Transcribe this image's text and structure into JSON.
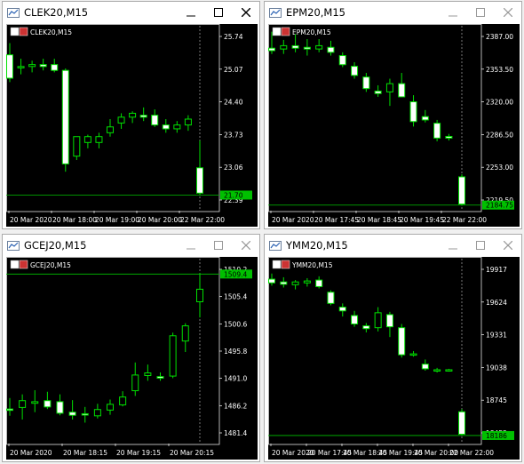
{
  "windows": [
    {
      "key": "w0",
      "title": "CLEK20,M15",
      "active": true,
      "symbol_label": "CLEK20,M15",
      "price_labels": [
        "25.74",
        "25.07",
        "24.40",
        "23.73",
        "23.06",
        "22.39"
      ],
      "current_price": "21.70",
      "time_labels": [
        "20 Mar 2020",
        "20 Mar 18:00",
        "20 Mar 19:00",
        "20 Mar 20:00",
        "22 Mar 22:00"
      ],
      "chart_data": {
        "type": "candlestick",
        "ylim": [
          21.3,
          26.0
        ],
        "candles": [
          {
            "o": 25.3,
            "h": 25.6,
            "l": 24.6,
            "c": 24.7
          },
          {
            "o": 25.0,
            "h": 25.2,
            "l": 24.8,
            "c": 25.0
          },
          {
            "o": 25.0,
            "h": 25.15,
            "l": 24.85,
            "c": 25.05
          },
          {
            "o": 25.05,
            "h": 25.2,
            "l": 24.9,
            "c": 25.0
          },
          {
            "o": 25.05,
            "h": 25.2,
            "l": 24.85,
            "c": 24.9
          },
          {
            "o": 24.9,
            "h": 24.95,
            "l": 22.3,
            "c": 22.5
          },
          {
            "o": 22.7,
            "h": 23.2,
            "l": 22.6,
            "c": 23.2
          },
          {
            "o": 23.05,
            "h": 23.25,
            "l": 22.9,
            "c": 23.2
          },
          {
            "o": 23.05,
            "h": 23.3,
            "l": 22.9,
            "c": 23.2
          },
          {
            "o": 23.3,
            "h": 23.65,
            "l": 23.2,
            "c": 23.45
          },
          {
            "o": 23.55,
            "h": 23.8,
            "l": 23.4,
            "c": 23.7
          },
          {
            "o": 23.7,
            "h": 23.85,
            "l": 23.55,
            "c": 23.8
          },
          {
            "o": 23.75,
            "h": 23.95,
            "l": 23.6,
            "c": 23.7
          },
          {
            "o": 23.75,
            "h": 23.9,
            "l": 23.45,
            "c": 23.5
          },
          {
            "o": 23.5,
            "h": 23.65,
            "l": 23.3,
            "c": 23.4
          },
          {
            "o": 23.4,
            "h": 23.6,
            "l": 23.3,
            "c": 23.5
          },
          {
            "o": 23.5,
            "h": 23.75,
            "l": 23.35,
            "c": 23.65
          },
          {
            "o": 22.4,
            "h": 23.1,
            "l": 21.7,
            "c": 21.75
          }
        ]
      }
    },
    {
      "key": "w1",
      "title": "EPM20,M15",
      "active": false,
      "symbol_label": "EPM20,M15",
      "price_labels": [
        "2387.00",
        "2353.50",
        "2320.00",
        "2286.50",
        "2253.00",
        "2219.50"
      ],
      "current_price": "2184.75",
      "time_labels": [
        "20 Mar 2020",
        "20 Mar 17:45",
        "20 Mar 18:45",
        "20 Mar 19:45",
        "22 Mar 22:00"
      ],
      "chart_data": {
        "type": "candlestick",
        "ylim": [
          2178,
          2400
        ],
        "candles": [
          {
            "o": 2375,
            "h": 2395,
            "l": 2368,
            "c": 2372
          },
          {
            "o": 2374,
            "h": 2385,
            "l": 2368,
            "c": 2378
          },
          {
            "o": 2378,
            "h": 2392,
            "l": 2370,
            "c": 2375
          },
          {
            "o": 2376,
            "h": 2386,
            "l": 2366,
            "c": 2374
          },
          {
            "o": 2374,
            "h": 2386,
            "l": 2370,
            "c": 2378
          },
          {
            "o": 2376,
            "h": 2384,
            "l": 2366,
            "c": 2370
          },
          {
            "o": 2366,
            "h": 2370,
            "l": 2352,
            "c": 2355
          },
          {
            "o": 2353,
            "h": 2358,
            "l": 2338,
            "c": 2342
          },
          {
            "o": 2340,
            "h": 2345,
            "l": 2322,
            "c": 2326
          },
          {
            "o": 2323,
            "h": 2330,
            "l": 2316,
            "c": 2320
          },
          {
            "o": 2322,
            "h": 2338,
            "l": 2305,
            "c": 2332
          },
          {
            "o": 2332,
            "h": 2345,
            "l": 2318,
            "c": 2316
          },
          {
            "o": 2310,
            "h": 2318,
            "l": 2280,
            "c": 2286
          },
          {
            "o": 2292,
            "h": 2300,
            "l": 2285,
            "c": 2288
          },
          {
            "o": 2284,
            "h": 2288,
            "l": 2262,
            "c": 2266
          },
          {
            "o": 2268,
            "h": 2271,
            "l": 2263,
            "c": 2266
          },
          {
            "o": 2219,
            "h": 2222,
            "l": 2184,
            "c": 2186
          }
        ]
      }
    },
    {
      "key": "w2",
      "title": "GCEJ20,M15",
      "active": false,
      "symbol_label": "GCEJ20,M15",
      "price_labels": [
        "1510.2",
        "1505.4",
        "1500.6",
        "1495.8",
        "1491.0",
        "1486.2",
        "1481.4"
      ],
      "current_price": "1509.4",
      "time_labels": [
        "20 Mar 2020",
        "20 Mar 18:15",
        "20 Mar 19:15",
        "20 Mar 20:15"
      ],
      "chart_data": {
        "type": "candlestick",
        "ylim": [
          1477,
          1512
        ],
        "candles": [
          {
            "o": 1483.6,
            "h": 1485.7,
            "l": 1482.3,
            "c": 1483.4
          },
          {
            "o": 1483.9,
            "h": 1486.4,
            "l": 1481.6,
            "c": 1485.2
          },
          {
            "o": 1484.7,
            "h": 1487.2,
            "l": 1483.0,
            "c": 1485.0
          },
          {
            "o": 1485.2,
            "h": 1486.9,
            "l": 1483.6,
            "c": 1484.0
          },
          {
            "o": 1485.0,
            "h": 1486.4,
            "l": 1482.4,
            "c": 1482.8
          },
          {
            "o": 1483.0,
            "h": 1485.3,
            "l": 1481.6,
            "c": 1482.4
          },
          {
            "o": 1482.7,
            "h": 1484.0,
            "l": 1481.0,
            "c": 1482.6
          },
          {
            "o": 1482.3,
            "h": 1484.6,
            "l": 1481.8,
            "c": 1483.5
          },
          {
            "o": 1483.4,
            "h": 1485.4,
            "l": 1482.5,
            "c": 1484.5
          },
          {
            "o": 1484.4,
            "h": 1487.0,
            "l": 1484.1,
            "c": 1485.9
          },
          {
            "o": 1487.1,
            "h": 1492.5,
            "l": 1486.1,
            "c": 1490.1
          },
          {
            "o": 1490.0,
            "h": 1492.1,
            "l": 1489.0,
            "c": 1490.5
          },
          {
            "o": 1489.8,
            "h": 1490.6,
            "l": 1489.0,
            "c": 1489.5
          },
          {
            "o": 1489.9,
            "h": 1498.2,
            "l": 1489.5,
            "c": 1497.6
          },
          {
            "o": 1496.6,
            "h": 1500.0,
            "l": 1494.5,
            "c": 1499.5
          },
          {
            "o": 1504.1,
            "h": 1509.6,
            "l": 1501.1,
            "c": 1506.5
          }
        ]
      }
    },
    {
      "key": "w3",
      "title": "YMM20,M15",
      "active": false,
      "symbol_label": "YMM20,M15",
      "price_labels": [
        "19917",
        "19624",
        "19331",
        "19038",
        "18745",
        "18452"
      ],
      "current_price": "18186",
      "time_labels": [
        "20 Mar 2020",
        "20 Mar 17:45",
        "20 Mar 18:45",
        "20 Mar 19:45",
        "20 Mar 20:00",
        "22 Mar 22:00"
      ],
      "chart_data": {
        "type": "candlestick",
        "ylim": [
          18100,
          20060
        ],
        "candles": [
          {
            "o": 19860,
            "h": 19920,
            "l": 19790,
            "c": 19820
          },
          {
            "o": 19830,
            "h": 19880,
            "l": 19770,
            "c": 19805
          },
          {
            "o": 19800,
            "h": 19850,
            "l": 19750,
            "c": 19830
          },
          {
            "o": 19820,
            "h": 19870,
            "l": 19780,
            "c": 19840
          },
          {
            "o": 19850,
            "h": 19890,
            "l": 19760,
            "c": 19780
          },
          {
            "o": 19720,
            "h": 19740,
            "l": 19580,
            "c": 19600
          },
          {
            "o": 19560,
            "h": 19600,
            "l": 19460,
            "c": 19520
          },
          {
            "o": 19470,
            "h": 19520,
            "l": 19350,
            "c": 19380
          },
          {
            "o": 19360,
            "h": 19390,
            "l": 19290,
            "c": 19330
          },
          {
            "o": 19340,
            "h": 19560,
            "l": 19300,
            "c": 19500
          },
          {
            "o": 19480,
            "h": 19510,
            "l": 19240,
            "c": 19350
          },
          {
            "o": 19340,
            "h": 19380,
            "l": 19020,
            "c": 19050
          },
          {
            "o": 19050,
            "h": 19090,
            "l": 19030,
            "c": 19060
          },
          {
            "o": 18950,
            "h": 19000,
            "l": 18880,
            "c": 18900
          },
          {
            "o": 18880,
            "h": 18910,
            "l": 18860,
            "c": 18890
          },
          {
            "o": 18880,
            "h": 18900,
            "l": 18870,
            "c": 18890
          },
          {
            "o": 18440,
            "h": 18470,
            "l": 18190,
            "c": 18200
          }
        ]
      }
    }
  ]
}
